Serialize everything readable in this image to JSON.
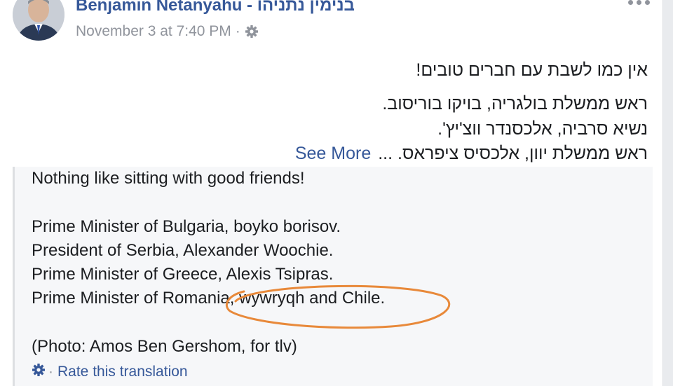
{
  "post": {
    "author": "Benjamin Netanyahu - בנימין נתניהו",
    "timestamp": "November 3 at 7:40 PM",
    "meta_separator": "·",
    "privacy_icon": "gear-icon",
    "more_icon": "more-options-icon",
    "original_lines": [
      "אין כמו לשבת עם חברים טובים!",
      "ראש ממשלת בולגריה, בויקו בוריסוב.",
      "נשיא סרביה, אלכסנדר ווצ'יץ'.",
      "ראש ממשלת יוון, אלכסיס ציפראס. ..."
    ],
    "see_more": "See More"
  },
  "translation": {
    "lines": [
      "Nothing like sitting with good friends!",
      "Prime Minister of Bulgaria, boyko borisov.",
      "President of Serbia, Alexander Woochie.",
      "Prime Minister of Greece, Alexis Tsipras.",
      "Prime Minister of Romania, wywryqh and Chile.",
      "(Photo: Amos Ben Gershom, for tlv)"
    ],
    "rate_separator": "·",
    "rate_label": "Rate this translation"
  },
  "colors": {
    "link": "#365899",
    "meta": "#90949c",
    "annotation": "#e8893a",
    "translation_bg": "#f6f7f9"
  }
}
